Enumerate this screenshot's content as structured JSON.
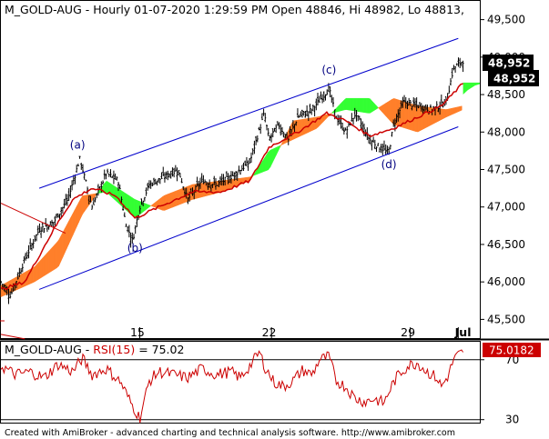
{
  "chart_data": [
    {
      "type": "candlestick",
      "symbol": "M_GOLD-AUG",
      "title": "M_GOLD-AUG - Hourly 01-07-2020 1:29:59 PM Open 48846, Hi 48982, Lo 48813,",
      "timeframe": "Hourly",
      "ohlc_last": {
        "open": 48846,
        "high": 48982,
        "low": 48813,
        "close": 48952
      },
      "x_ticks": [
        "15",
        "22",
        "29",
        "Jul"
      ],
      "y_ticks": [
        45500,
        46000,
        46500,
        47000,
        47500,
        48000,
        48500,
        49000,
        49500
      ],
      "y_tick_labels": [
        "45,500",
        "46,000",
        "46,500",
        "47,000",
        "47,500",
        "48,000",
        "48,500",
        "49,000",
        "49,500"
      ],
      "ylim": [
        45250,
        49750
      ],
      "grid": false,
      "price_labels": [
        "48,952",
        "48,952"
      ],
      "price_label_value": 48952,
      "annotations": [
        {
          "label": "(a)",
          "x": 0.16,
          "y": 47780
        },
        {
          "label": "(b)",
          "x": 0.28,
          "y": 46400
        },
        {
          "label": "(c)",
          "x": 0.685,
          "y": 48780
        },
        {
          "label": "(d)",
          "x": 0.81,
          "y": 47520
        }
      ],
      "channel_lines": [
        {
          "name": "upper",
          "x": [
            0.08,
            0.955
          ],
          "y": [
            47250,
            49250
          ]
        },
        {
          "name": "lower",
          "x": [
            0.08,
            0.955
          ],
          "y": [
            45900,
            48070
          ]
        },
        {
          "name": "red_line",
          "x": [
            0.0,
            0.135
          ],
          "y": [
            47050,
            46650
          ]
        },
        {
          "name": "red_line_bottom",
          "x": [
            0.0,
            0.05
          ],
          "y": [
            45300,
            45240
          ]
        }
      ],
      "price_anchors": {
        "x": [
          0.0,
          0.02,
          0.05,
          0.08,
          0.11,
          0.14,
          0.165,
          0.19,
          0.22,
          0.245,
          0.26,
          0.275,
          0.29,
          0.31,
          0.34,
          0.37,
          0.39,
          0.42,
          0.45,
          0.48,
          0.5,
          0.52,
          0.55,
          0.56,
          0.58,
          0.6,
          0.62,
          0.65,
          0.685,
          0.7,
          0.72,
          0.74,
          0.77,
          0.79,
          0.81,
          0.82,
          0.84,
          0.87,
          0.9,
          0.93,
          0.945,
          0.955,
          0.965
        ],
        "y": [
          46000,
          45820,
          46300,
          46700,
          46800,
          47100,
          47650,
          47000,
          47450,
          47350,
          46800,
          46550,
          47000,
          47300,
          47400,
          47500,
          47100,
          47350,
          47300,
          47400,
          47500,
          47600,
          48250,
          47900,
          48100,
          47900,
          48200,
          48300,
          48580,
          48200,
          48000,
          48250,
          47900,
          47800,
          47720,
          48100,
          48400,
          48350,
          48300,
          48400,
          48850,
          48900,
          48952
        ]
      },
      "ma_red_anchors": {
        "x": [
          0.0,
          0.05,
          0.11,
          0.15,
          0.19,
          0.24,
          0.28,
          0.33,
          0.4,
          0.46,
          0.52,
          0.56,
          0.62,
          0.68,
          0.72,
          0.77,
          0.82,
          0.87,
          0.92,
          0.95,
          0.965
        ],
        "y": [
          45900,
          46000,
          46700,
          47100,
          47250,
          47150,
          46850,
          47000,
          47200,
          47200,
          47350,
          47800,
          48000,
          48250,
          48150,
          47950,
          48050,
          48200,
          48350,
          48550,
          48650
        ]
      },
      "cloud_anchors": {
        "x": [
          0.0,
          0.07,
          0.12,
          0.17,
          0.22,
          0.28,
          0.34,
          0.4,
          0.46,
          0.52,
          0.56,
          0.61,
          0.66,
          0.72,
          0.77,
          0.82,
          0.87,
          0.93,
          0.965
        ],
        "a": [
          45800,
          46000,
          46200,
          46900,
          47350,
          47100,
          46950,
          47100,
          47200,
          47350,
          47750,
          47900,
          48050,
          48450,
          48450,
          48100,
          48000,
          48200,
          48300
        ],
        "b": [
          45950,
          46200,
          46550,
          47150,
          47200,
          46850,
          47150,
          47300,
          47350,
          47400,
          47500,
          48150,
          48200,
          48300,
          48250,
          48450,
          48350,
          48300,
          48350
        ]
      },
      "cloud_future_anchors": {
        "x": [
          0.965,
          0.975,
          0.99,
          1.0
        ],
        "a": [
          48500,
          48560,
          48620,
          48640
        ],
        "b": [
          48660,
          48660,
          48660,
          48660
        ]
      },
      "colors": {
        "candles": "#000000",
        "bullish_cloud": "#33ff33",
        "bearish_cloud": "#ff7f2a",
        "moving_average": "#cc0000",
        "channel": "#0000cc",
        "marker_red": "#cc0000",
        "annotation": "#000080",
        "axis": "#000000"
      }
    },
    {
      "type": "line",
      "title": "M_GOLD-AUG - RSI(15) = 75.02",
      "title_parts": {
        "symbol": "M_GOLD-AUG",
        "sep": " - ",
        "indicator": "RSI(15)",
        "value": " = 75.02"
      },
      "y_ticks": [
        70,
        30
      ],
      "ylim": [
        28,
        82
      ],
      "levels": [
        70,
        30
      ],
      "last_value_label": "75.0182",
      "last_value": 75.0182,
      "rsi_anchors": {
        "x": [
          0.0,
          0.03,
          0.06,
          0.09,
          0.12,
          0.15,
          0.17,
          0.19,
          0.22,
          0.25,
          0.27,
          0.29,
          0.31,
          0.33,
          0.36,
          0.39,
          0.42,
          0.45,
          0.48,
          0.5,
          0.52,
          0.54,
          0.55,
          0.57,
          0.59,
          0.61,
          0.63,
          0.65,
          0.665,
          0.685,
          0.7,
          0.72,
          0.74,
          0.76,
          0.78,
          0.8,
          0.815,
          0.83,
          0.85,
          0.87,
          0.89,
          0.91,
          0.92,
          0.935,
          0.945,
          0.955,
          0.965
        ],
        "y": [
          66,
          60,
          62,
          58,
          67,
          62,
          71,
          60,
          64,
          55,
          42,
          31,
          56,
          62,
          60,
          58,
          64,
          60,
          62,
          58,
          66,
          75,
          66,
          55,
          52,
          56,
          63,
          60,
          70,
          72,
          56,
          52,
          44,
          42,
          44,
          41,
          52,
          60,
          66,
          68,
          62,
          58,
          52,
          60,
          70,
          73,
          75.02
        ]
      },
      "colors": {
        "line": "#cc0000",
        "levels": "#000000"
      }
    }
  ],
  "footer": "Created with AmiBroker - advanced charting and technical analysis software. http://www.amibroker.com"
}
